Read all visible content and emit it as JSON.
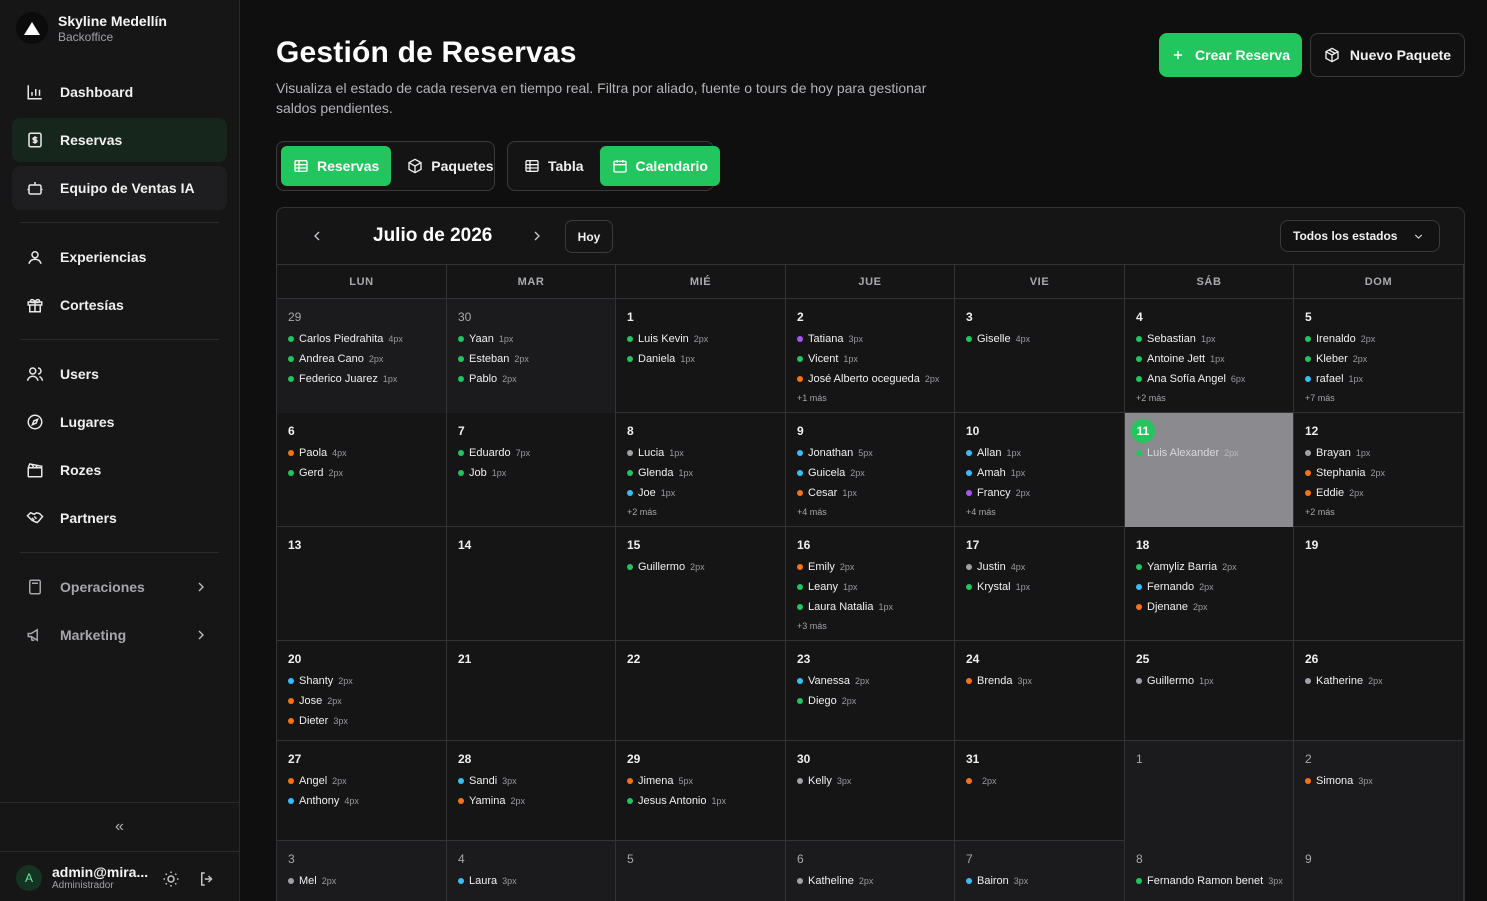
{
  "colors": {
    "accent": "#22c55e",
    "dot_green": "#22c55e",
    "dot_orange": "#f97316",
    "dot_blue": "#38bdf8",
    "dot_purple": "#a855f7",
    "dot_gray": "#a1a1aa"
  },
  "brand": {
    "name": "Skyline Medellín",
    "subtitle": "Backoffice"
  },
  "nav": {
    "dashboard": "Dashboard",
    "reservas": "Reservas",
    "equipo": "Equipo de Ventas IA",
    "experiencias": "Experiencias",
    "cortesias": "Cortesías",
    "users": "Users",
    "lugares": "Lugares",
    "rozes": "Rozes",
    "partners": "Partners",
    "operaciones": "Operaciones",
    "marketing": "Marketing"
  },
  "sidebar_footer": {
    "collapse_glyph": "«",
    "user_name": "admin@mira...",
    "user_role": "Administrador",
    "avatar_letter": "A"
  },
  "header": {
    "title": "Gestión de Reservas",
    "description": "Visualiza el estado de cada reserva en tiempo real. Filtra por aliado, fuente o tours de hoy para gestionar saldos pendientes.",
    "create_label": "Crear Reserva",
    "package_label": "Nuevo Paquete"
  },
  "toggles": {
    "reservas": "Reservas",
    "paquetes": "Paquetes",
    "tabla": "Tabla",
    "calendario": "Calendario"
  },
  "calendar": {
    "month_label": "Julio de 2026",
    "today_label": "Hoy",
    "status_filter": "Todos los estados",
    "weekdays": [
      "LUN",
      "MAR",
      "MIÉ",
      "JUE",
      "VIE",
      "SÁB",
      "DOM"
    ],
    "weeks": [
      [
        {
          "n": "29",
          "dim": true,
          "events": [
            {
              "name": "Carlos Piedrahita",
              "count": "4px",
              "c": "g"
            },
            {
              "name": "Andrea Cano",
              "count": "2px",
              "c": "g"
            },
            {
              "name": "Federico Juarez",
              "count": "1px",
              "c": "g"
            }
          ]
        },
        {
          "n": "30",
          "dim": true,
          "events": [
            {
              "name": "Yaan",
              "count": "1px",
              "c": "g"
            },
            {
              "name": "Esteban",
              "count": "2px",
              "c": "g"
            },
            {
              "name": "Pablo",
              "count": "2px",
              "c": "g"
            }
          ]
        },
        {
          "n": "1",
          "events": [
            {
              "name": "Luis Kevin",
              "count": "2px",
              "c": "g"
            },
            {
              "name": "Daniela",
              "count": "1px",
              "c": "g"
            }
          ]
        },
        {
          "n": "2",
          "events": [
            {
              "name": "Tatiana",
              "count": "3px",
              "c": "p"
            },
            {
              "name": "Vicent",
              "count": "1px",
              "c": "g"
            },
            {
              "name": "José Alberto ocegueda",
              "count": "2px",
              "c": "o"
            }
          ],
          "more": "+1 más"
        },
        {
          "n": "3",
          "events": [
            {
              "name": "Giselle",
              "count": "4px",
              "c": "g"
            }
          ]
        },
        {
          "n": "4",
          "events": [
            {
              "name": "Sebastian",
              "count": "1px",
              "c": "g"
            },
            {
              "name": "Antoine Jett",
              "count": "1px",
              "c": "g"
            },
            {
              "name": "Ana Sofía Angel",
              "count": "6px",
              "c": "g"
            }
          ],
          "more": "+2 más"
        },
        {
          "n": "5",
          "events": [
            {
              "name": "Irenaldo",
              "count": "2px",
              "c": "g"
            },
            {
              "name": "Kleber",
              "count": "2px",
              "c": "g"
            },
            {
              "name": "rafael",
              "count": "1px",
              "c": "b"
            }
          ],
          "more": "+7 más"
        }
      ],
      [
        {
          "n": "6",
          "events": [
            {
              "name": "Paola",
              "count": "4px",
              "c": "o"
            },
            {
              "name": "Gerd",
              "count": "2px",
              "c": "g"
            }
          ]
        },
        {
          "n": "7",
          "events": [
            {
              "name": "Eduardo",
              "count": "7px",
              "c": "g"
            },
            {
              "name": "Job",
              "count": "1px",
              "c": "g"
            }
          ]
        },
        {
          "n": "8",
          "events": [
            {
              "name": "Lucia",
              "count": "1px",
              "c": "x"
            },
            {
              "name": "Glenda",
              "count": "1px",
              "c": "g"
            },
            {
              "name": "Joe",
              "count": "1px",
              "c": "b"
            }
          ],
          "more": "+2 más"
        },
        {
          "n": "9",
          "events": [
            {
              "name": "Jonathan",
              "count": "5px",
              "c": "b"
            },
            {
              "name": "Guicela",
              "count": "2px",
              "c": "b"
            },
            {
              "name": "Cesar",
              "count": "1px",
              "c": "o"
            }
          ],
          "more": "+4 más"
        },
        {
          "n": "10",
          "events": [
            {
              "name": "Allan",
              "count": "1px",
              "c": "b"
            },
            {
              "name": "Amah",
              "count": "1px",
              "c": "b"
            },
            {
              "name": "Francy",
              "count": "2px",
              "c": "p"
            }
          ],
          "more": "+4 más"
        },
        {
          "n": "11",
          "today": true,
          "events": [
            {
              "name": "Luis Alexander",
              "count": "2px",
              "c": "g"
            }
          ]
        },
        {
          "n": "12",
          "events": [
            {
              "name": "Brayan",
              "count": "1px",
              "c": "x"
            },
            {
              "name": "Stephania",
              "count": "2px",
              "c": "o"
            },
            {
              "name": "Eddie",
              "count": "2px",
              "c": "o"
            }
          ],
          "more": "+2 más"
        }
      ],
      [
        {
          "n": "13",
          "events": []
        },
        {
          "n": "14",
          "events": []
        },
        {
          "n": "15",
          "events": [
            {
              "name": "Guillermo",
              "count": "2px",
              "c": "g"
            }
          ]
        },
        {
          "n": "16",
          "events": [
            {
              "name": "Emily",
              "count": "2px",
              "c": "o"
            },
            {
              "name": "Leany",
              "count": "1px",
              "c": "g"
            },
            {
              "name": "Laura Natalia",
              "count": "1px",
              "c": "g"
            }
          ],
          "more": "+3 más"
        },
        {
          "n": "17",
          "events": [
            {
              "name": "Justin",
              "count": "4px",
              "c": "x"
            },
            {
              "name": "Krystal",
              "count": "1px",
              "c": "g"
            }
          ]
        },
        {
          "n": "18",
          "events": [
            {
              "name": "Yamyliz Barria",
              "count": "2px",
              "c": "g"
            },
            {
              "name": "Fernando",
              "count": "2px",
              "c": "b"
            },
            {
              "name": "Djenane",
              "count": "2px",
              "c": "o"
            }
          ]
        },
        {
          "n": "19",
          "events": []
        }
      ],
      [
        {
          "n": "20",
          "events": [
            {
              "name": "Shanty",
              "count": "2px",
              "c": "b"
            },
            {
              "name": "Jose",
              "count": "2px",
              "c": "o"
            },
            {
              "name": "Dieter",
              "count": "3px",
              "c": "o"
            }
          ]
        },
        {
          "n": "21",
          "events": []
        },
        {
          "n": "22",
          "events": []
        },
        {
          "n": "23",
          "events": [
            {
              "name": "Vanessa",
              "count": "2px",
              "c": "b"
            },
            {
              "name": "Diego",
              "count": "2px",
              "c": "g"
            }
          ]
        },
        {
          "n": "24",
          "events": [
            {
              "name": "Brenda",
              "count": "3px",
              "c": "o"
            }
          ]
        },
        {
          "n": "25",
          "events": [
            {
              "name": "Guillermo",
              "count": "1px",
              "c": "x"
            }
          ]
        },
        {
          "n": "26",
          "events": [
            {
              "name": "Katherine",
              "count": "2px",
              "c": "x"
            }
          ]
        }
      ],
      [
        {
          "n": "27",
          "events": [
            {
              "name": "Angel",
              "count": "2px",
              "c": "o"
            },
            {
              "name": "Anthony",
              "count": "4px",
              "c": "b"
            }
          ]
        },
        {
          "n": "28",
          "events": [
            {
              "name": "Sandi",
              "count": "3px",
              "c": "b"
            },
            {
              "name": "Yamina",
              "count": "2px",
              "c": "o"
            }
          ]
        },
        {
          "n": "29",
          "events": [
            {
              "name": "Jimena",
              "count": "5px",
              "c": "o"
            },
            {
              "name": "Jesus Antonio",
              "count": "1px",
              "c": "g"
            }
          ]
        },
        {
          "n": "30",
          "events": [
            {
              "name": "Kelly",
              "count": "3px",
              "c": "x"
            }
          ]
        },
        {
          "n": "31",
          "events": [
            {
              "name": "",
              "count": "2px",
              "c": "o"
            }
          ]
        },
        {
          "n": "1",
          "dim": true,
          "events": []
        },
        {
          "n": "2",
          "dim": true,
          "events": [
            {
              "name": "Simona",
              "count": "3px",
              "c": "o"
            }
          ]
        }
      ],
      [
        {
          "n": "3",
          "dim": true,
          "events": [
            {
              "name": "Mel",
              "count": "2px",
              "c": "x"
            }
          ]
        },
        {
          "n": "4",
          "dim": true,
          "events": [
            {
              "name": "Laura",
              "count": "3px",
              "c": "b"
            }
          ]
        },
        {
          "n": "5",
          "dim": true,
          "events": []
        },
        {
          "n": "6",
          "dim": true,
          "events": [
            {
              "name": "Katheline",
              "count": "2px",
              "c": "x"
            }
          ]
        },
        {
          "n": "7",
          "dim": true,
          "events": [
            {
              "name": "Bairon",
              "count": "3px",
              "c": "b"
            }
          ]
        },
        {
          "n": "8",
          "dim": true,
          "events": [
            {
              "name": "Fernando Ramon benet",
              "count": "3px",
              "c": "g"
            }
          ]
        },
        {
          "n": "9",
          "dim": true,
          "events": []
        }
      ]
    ]
  }
}
